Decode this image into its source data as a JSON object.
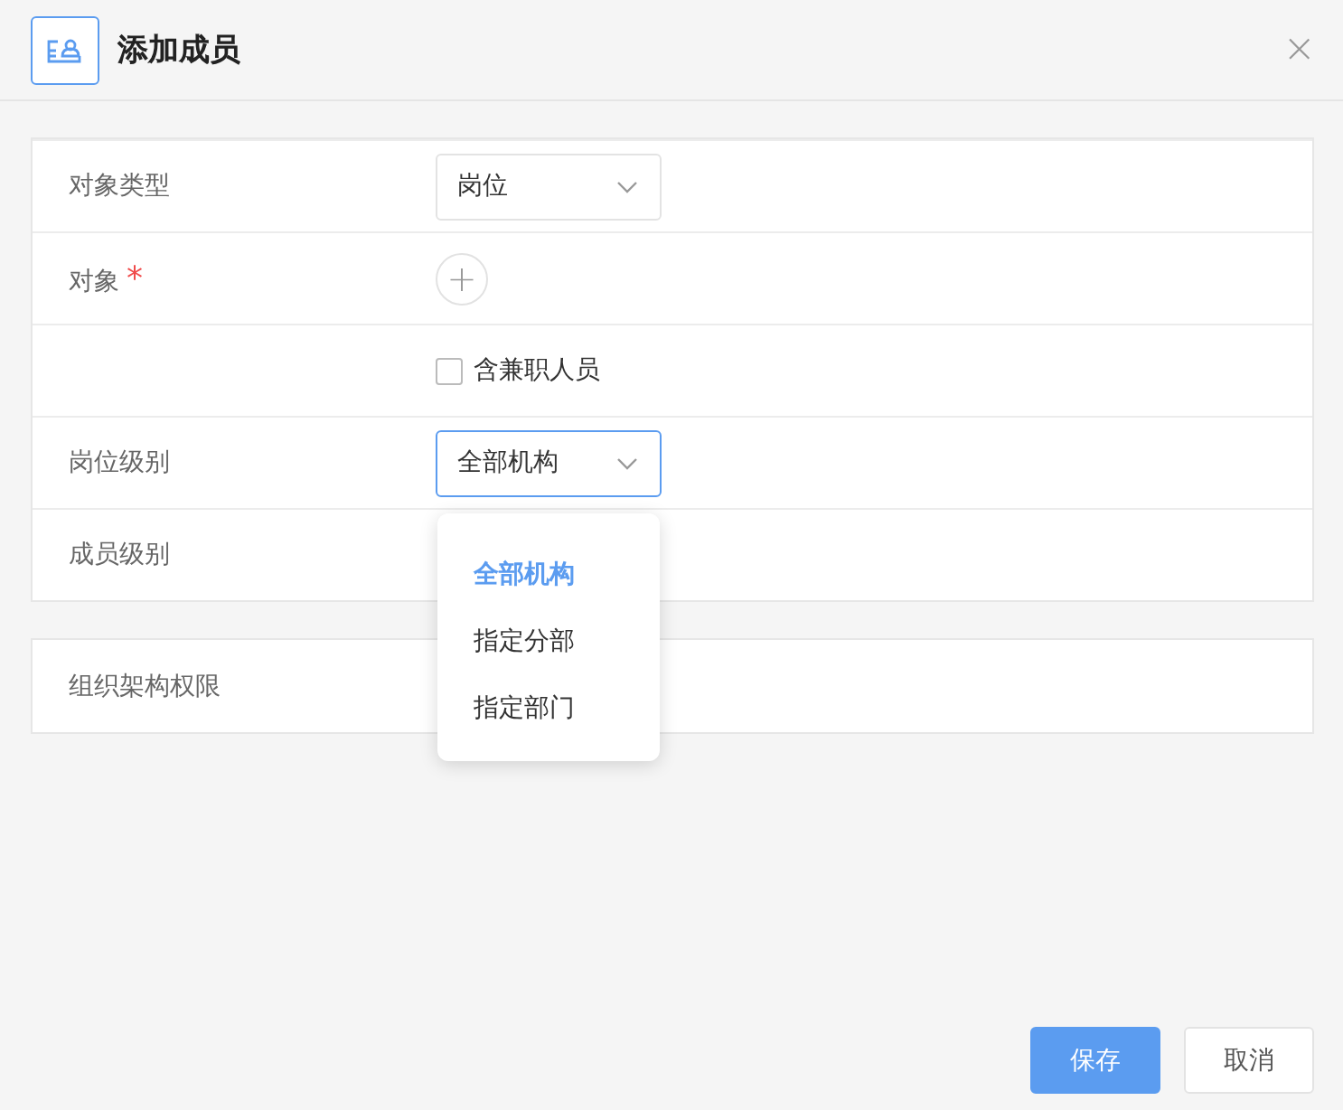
{
  "dialog": {
    "title": "添加成员",
    "close": "×"
  },
  "form_rows": [
    {
      "kind": "select",
      "label": "对象类型",
      "value": "岗位",
      "open": false
    },
    {
      "kind": "picker",
      "label": "对象",
      "required_mark": "*",
      "add": "+"
    },
    {
      "kind": "checkbox",
      "text": "含兼职人员",
      "checked": false
    },
    {
      "kind": "select",
      "label": "岗位级别",
      "value": "全部机构",
      "open": true,
      "options": [
        {
          "label": "全部机构",
          "selected": true
        },
        {
          "label": "指定分部",
          "selected": false
        },
        {
          "label": "指定部门",
          "selected": false
        }
      ]
    },
    {
      "kind": "empty",
      "label": "成员级别"
    }
  ],
  "permission_section": {
    "label": "组织架构权限"
  },
  "buttons": [
    {
      "label": "保存",
      "kind": "primary"
    },
    {
      "label": "取消",
      "kind": "default"
    }
  ]
}
